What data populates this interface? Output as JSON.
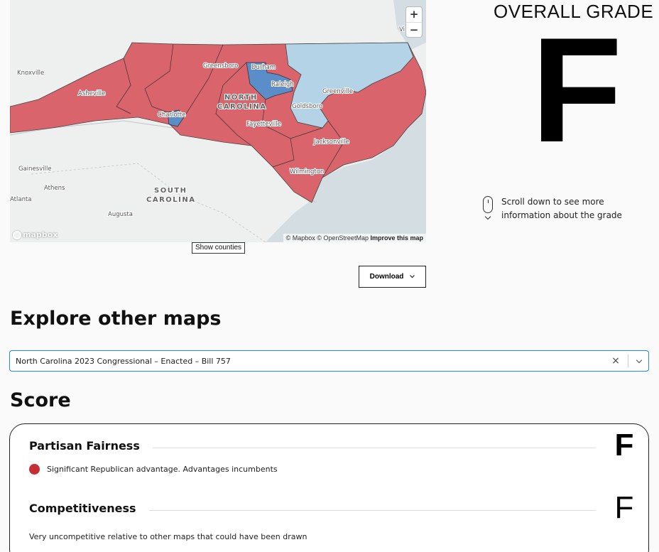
{
  "map": {
    "zoom_in": "+",
    "zoom_out": "−",
    "logo": "mapbox",
    "attribution_mapbox": "© Mapbox",
    "attribution_osm": "© OpenStreetMap",
    "attribution_improve": "Improve this map",
    "labels": {
      "knoxville": "Knoxville",
      "asheville": "Asheville",
      "greensboro": "Greensboro",
      "durham": "Durham",
      "raleigh": "Raleigh",
      "state_1": "NORTH",
      "state_2": "CAROLINA",
      "charlotte": "Charlotte",
      "fayetteville": "Fayetteville",
      "goldsboro": "Goldsboro",
      "greenville": "Greenville",
      "jacksonville": "Jacksonville",
      "wilmington": "Wilmington",
      "gainesville": "Gainesville",
      "athens": "Athens",
      "atlanta": "Atlanta",
      "sc_1": "SOUTH",
      "sc_2": "CAROLINA",
      "augusta": "Augusta",
      "virginia_partial": "Vi"
    },
    "colors": {
      "republican": "#d9646b",
      "democratic": "#5b8ec9",
      "lean_democratic": "#b5d3e7",
      "land": "#eef0f0",
      "water": "#cdd6dc"
    }
  },
  "show_counties_label": "Show counties",
  "download_label": "Download",
  "grade_panel": {
    "title": "OVERALL GRADE",
    "grade": "F",
    "scroll_hint": "Scroll down to see more information about the grade"
  },
  "explore": {
    "heading": "Explore other maps",
    "selected": "North Carolina 2023 Congressional – Enacted – Bill 757",
    "clear": "×"
  },
  "score": {
    "heading": "Score",
    "metrics": [
      {
        "name": "Partisan Fairness",
        "grade": "F",
        "description": "Significant Republican advantage. Advantages incumbents",
        "dot_color": "#c62d35"
      },
      {
        "name": "Competitiveness",
        "grade": "F",
        "description": "Very uncompetitive relative to other maps that could have been drawn"
      }
    ]
  }
}
